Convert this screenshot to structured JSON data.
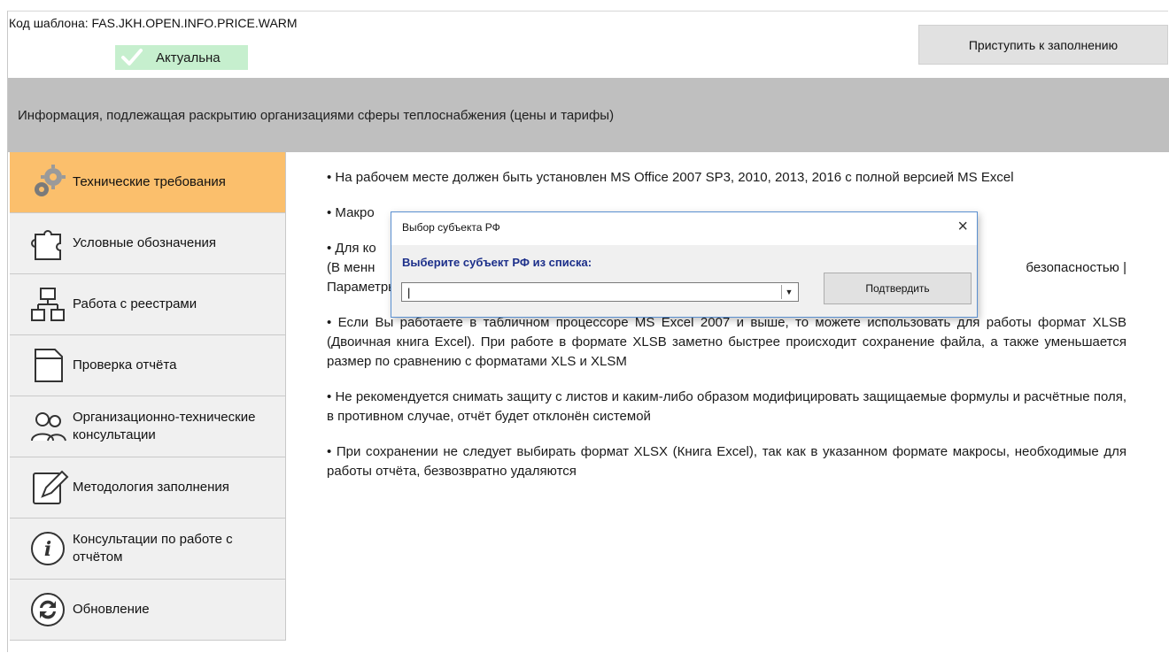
{
  "template": {
    "code_label": "Код шаблона: FAS.JKH.OPEN.INFO.PRICE.WARM",
    "status": "Актуальна",
    "start_button": "Приступить к заполнению"
  },
  "header": {
    "title": "Информация, подлежащая раскрытию организациями сферы теплоснабжения (цены и тарифы)"
  },
  "sidebar": {
    "items": [
      {
        "label": "Технические требования",
        "icon": "gears-icon",
        "active": true
      },
      {
        "label": "Условные обозначения",
        "icon": "puzzle-icon",
        "active": false
      },
      {
        "label": "Работа с реестрами",
        "icon": "network-icon",
        "active": false
      },
      {
        "label": "Проверка отчёта",
        "icon": "document-icon",
        "active": false
      },
      {
        "label": "Организационно-технические консультации",
        "icon": "people-icon",
        "active": false
      },
      {
        "label": "Методология заполнения",
        "icon": "pencil-icon",
        "active": false
      },
      {
        "label": "Консультации по работе с отчётом",
        "icon": "info-icon",
        "active": false
      },
      {
        "label": "Обновление",
        "icon": "refresh-icon",
        "active": false
      }
    ]
  },
  "content": {
    "paragraphs": [
      "• На рабочем месте должен быть установлен MS Office 2007 SP3, 2010, 2013, 2016 с полной версией MS Excel",
      "• Макро",
      "• Для ко",
      "(В менн",
      "безопасностью |",
      "Параметры центра управления безопасностью | Параметры макросов | Включить все макросы | ОК)",
      "• Если Вы работаете в табличном процессоре MS Excel 2007 и выше, то можете использовать для работы формат XLSB (Двоичная книга Excel). При работе в формате XLSB заметно быстрее происходит сохранение файла, а также уменьшается размер по сравнению с форматами XLS и XLSM",
      "• Не рекомендуется снимать защиту с листов и каким-либо образом модифицировать защищаемые формулы и расчётные поля, в противном случае, отчёт будет отклонён системой",
      "• При сохранении не следует выбирать формат XLSX (Книга Excel), так как в указанном формате макросы, необходимые для работы отчёта, безвозвратно удаляются"
    ]
  },
  "dialog": {
    "title": "Выбор субъекта РФ",
    "close": "×",
    "prompt": "Выберите субъект РФ из списка:",
    "combo_value": "|",
    "confirm_button": "Подтвердить"
  },
  "colors": {
    "active_item": "#fbbf6c",
    "status_badge": "#c6efce",
    "header_band": "#bfbfbf",
    "dialog_prompt": "#1c2f8a"
  }
}
